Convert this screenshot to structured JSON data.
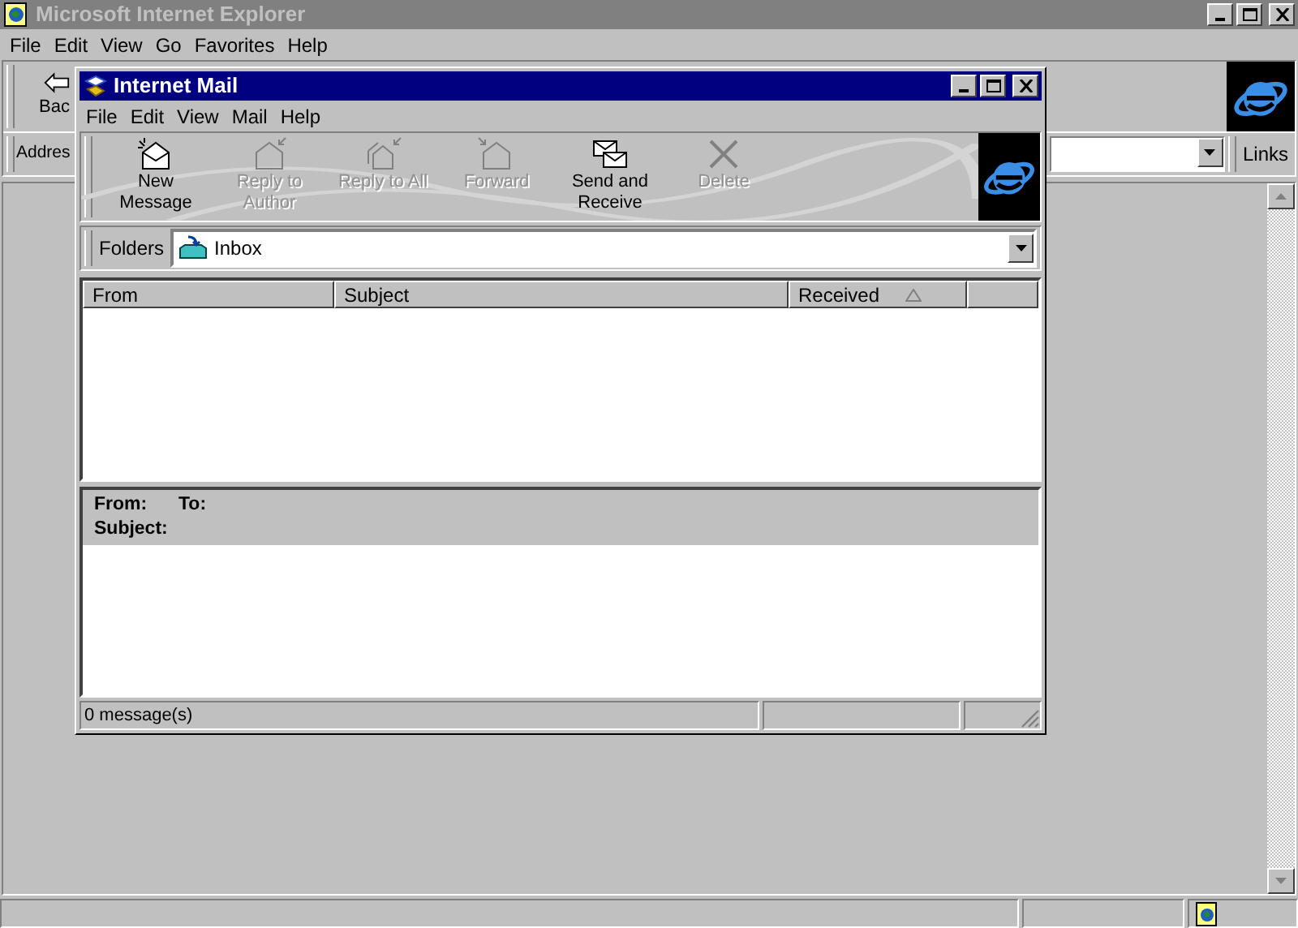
{
  "browser": {
    "title": "Microsoft Internet Explorer",
    "active": false,
    "menu": [
      "File",
      "Edit",
      "View",
      "Go",
      "Favorites",
      "Help"
    ],
    "back_label": "Bac",
    "address_label": "Addres",
    "links_label": "Links"
  },
  "mail": {
    "title": "Internet Mail",
    "active": true,
    "menu": [
      "File",
      "Edit",
      "View",
      "Mail",
      "Help"
    ],
    "toolbar": [
      {
        "kind": "new",
        "label": "New Message",
        "disabled": false
      },
      {
        "kind": "reply",
        "label": "Reply to Author",
        "disabled": true
      },
      {
        "kind": "reply_all",
        "label": "Reply to All",
        "disabled": true
      },
      {
        "kind": "forward",
        "label": "Forward",
        "disabled": true
      },
      {
        "kind": "send_receive",
        "label": "Send and Receive",
        "disabled": false
      },
      {
        "kind": "delete",
        "label": "Delete",
        "disabled": true
      }
    ],
    "folders_label": "Folders",
    "folder": "Inbox",
    "columns": [
      {
        "label": "From",
        "sorted": false
      },
      {
        "label": "Subject",
        "sorted": false
      },
      {
        "label": "Received",
        "sorted": true
      }
    ],
    "preview": {
      "from_label": "From:",
      "to_label": "To:",
      "subject_label": "Subject:"
    },
    "status": "0 message(s)"
  }
}
